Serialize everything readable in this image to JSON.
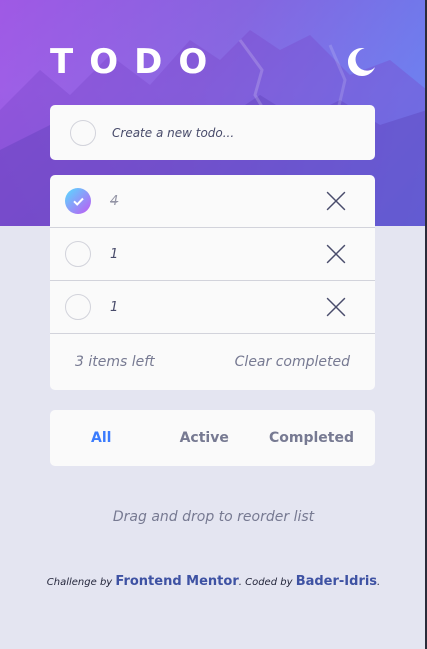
{
  "header": {
    "logo": "TODO",
    "theme_icon": "moon-icon"
  },
  "create": {
    "placeholder": "Create a new todo..."
  },
  "todos": [
    {
      "text": "4",
      "completed": true
    },
    {
      "text": "1",
      "completed": false
    },
    {
      "text": "1",
      "completed": false
    }
  ],
  "list_footer": {
    "items_left": "3 items left",
    "clear_label": "Clear completed"
  },
  "filters": {
    "all": "All",
    "active": "Active",
    "completed": "Completed",
    "selected": "All"
  },
  "hint": "Drag and drop to reorder list",
  "attribution": {
    "prefix": "Challenge by",
    "link1": "Frontend Mentor",
    "middle": ". Coded by",
    "link2": "Bader-Idris",
    "suffix": "."
  },
  "colors": {
    "accent": "#3a7bfd",
    "check_start": "#57ddff",
    "check_end": "#c058f3",
    "background": "#e4e5f1"
  }
}
